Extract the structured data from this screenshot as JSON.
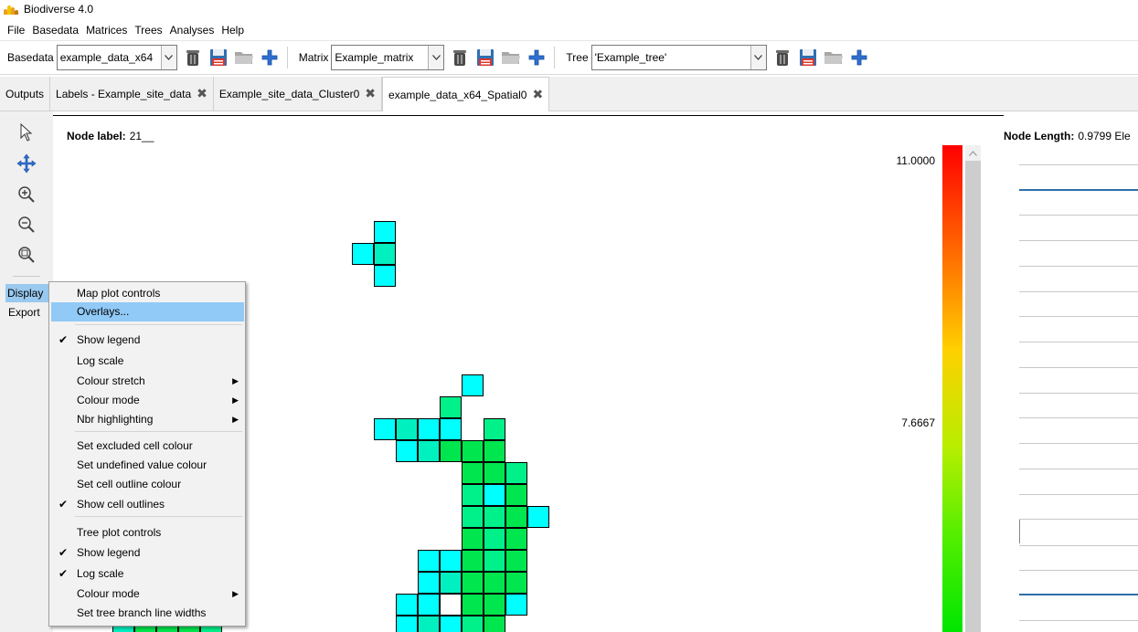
{
  "window": {
    "title": "Biodiverse 4.0"
  },
  "menubar": [
    "File",
    "Basedata",
    "Matrices",
    "Trees",
    "Analyses",
    "Help"
  ],
  "toolbar": {
    "basedata_label": "Basedata",
    "basedata_value": "example_data_x64",
    "matrix_label": "Matrix",
    "matrix_value": "Example_matrix",
    "tree_label": "Tree",
    "tree_value": "'Example_tree'"
  },
  "tabs": [
    {
      "label": "Outputs",
      "closable": false,
      "active": false
    },
    {
      "label": "Labels - Example_site_data",
      "closable": true,
      "active": false
    },
    {
      "label": "Example_site_data_Cluster0",
      "closable": true,
      "active": false
    },
    {
      "label": "example_data_x64_Spatial0",
      "closable": true,
      "active": true
    }
  ],
  "side_buttons": {
    "display": "Display",
    "export": "Export"
  },
  "plot": {
    "node_label_title": "Node label:",
    "node_label_value": "21__",
    "node_length_title": "Node Length:",
    "node_length_value": "0.9799 Ele",
    "legend_max": "11.0000",
    "legend_mid": "7.6667",
    "cell_colors": {
      "cyan": "#00ffff",
      "aqua_green": "#00f0c0",
      "mint": "#00f08a",
      "green": "#00e64e",
      "white": "#ffffff"
    }
  },
  "context_menu": [
    {
      "label": "Map plot controls",
      "checked": false,
      "submenu": false,
      "highlighted": false
    },
    {
      "label": "Overlays...",
      "checked": false,
      "submenu": false,
      "highlighted": true
    },
    {
      "label": "Show legend",
      "checked": true,
      "submenu": false,
      "highlighted": false
    },
    {
      "label": "Log scale",
      "checked": false,
      "submenu": false,
      "highlighted": false
    },
    {
      "label": "Colour stretch",
      "checked": false,
      "submenu": true,
      "highlighted": false
    },
    {
      "label": "Colour mode",
      "checked": false,
      "submenu": true,
      "highlighted": false
    },
    {
      "label": "Nbr highlighting",
      "checked": false,
      "submenu": true,
      "highlighted": false
    },
    {
      "label": "Set excluded cell colour",
      "checked": false,
      "submenu": false,
      "highlighted": false
    },
    {
      "label": "Set undefined value colour",
      "checked": false,
      "submenu": false,
      "highlighted": false
    },
    {
      "label": "Set cell outline colour",
      "checked": false,
      "submenu": false,
      "highlighted": false
    },
    {
      "label": "Show cell outlines",
      "checked": true,
      "submenu": false,
      "highlighted": false
    },
    {
      "label": "Tree plot controls",
      "checked": false,
      "submenu": false,
      "highlighted": false
    },
    {
      "label": "Show legend",
      "checked": true,
      "submenu": false,
      "highlighted": false
    },
    {
      "label": "Log scale",
      "checked": true,
      "submenu": false,
      "highlighted": false
    },
    {
      "label": "Colour mode",
      "checked": false,
      "submenu": true,
      "highlighted": false
    },
    {
      "label": "Set tree branch line widths",
      "checked": false,
      "submenu": false,
      "highlighted": false
    }
  ]
}
